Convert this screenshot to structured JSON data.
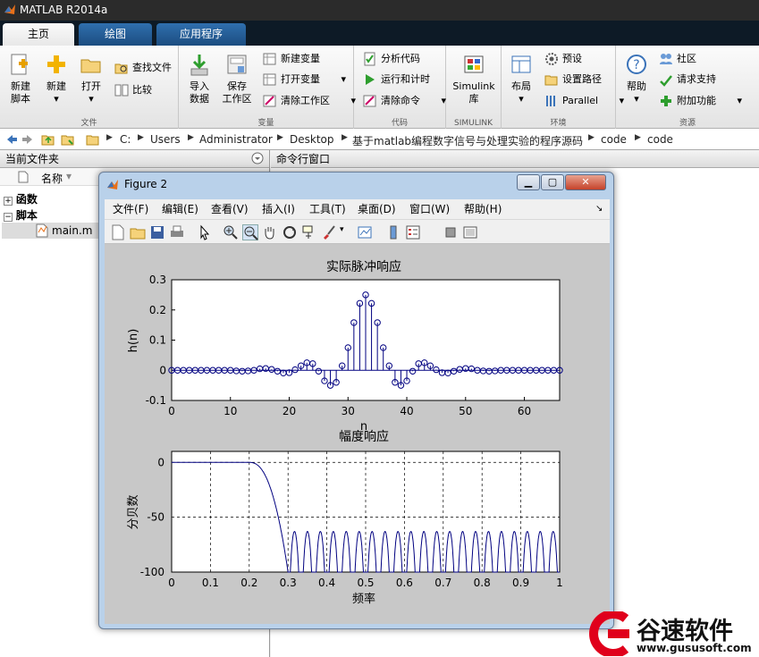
{
  "app": {
    "title": "MATLAB R2014a"
  },
  "tabs": [
    {
      "label": "主页"
    },
    {
      "label": "绘图"
    },
    {
      "label": "应用程序"
    }
  ],
  "ribbon": {
    "file": {
      "label": "文件",
      "new_script": "新建\n脚本",
      "new": "新建",
      "open": "打开",
      "find_files": "查找文件",
      "compare": "比较"
    },
    "variable": {
      "label": "变量",
      "import": "导入\n数据",
      "save_ws": "保存\n工作区",
      "new_var": "新建变量",
      "open_var": "打开变量",
      "clear_ws": "清除工作区"
    },
    "code": {
      "label": "代码",
      "analyze": "分析代码",
      "run_time": "运行和计时",
      "clear_cmd": "清除命令"
    },
    "simulink": {
      "label": "SIMULINK",
      "btn": "Simulink\n库"
    },
    "env": {
      "label": "环境",
      "layout": "布局",
      "prefs": "预设",
      "set_path": "设置路径",
      "parallel": "Parallel"
    },
    "resources": {
      "label": "资源",
      "help": "帮助",
      "community": "社区",
      "support": "请求支持",
      "addons": "附加功能"
    }
  },
  "address": {
    "crumbs": [
      "C:",
      "Users",
      "Administrator",
      "Desktop",
      "基于matlab编程数字信号与处理实验的程序源码",
      "code",
      "code"
    ]
  },
  "left_pane": {
    "header": "当前文件夹",
    "col_name": "名称",
    "tree": [
      {
        "label": "函数",
        "toggle": "+"
      },
      {
        "label": "脚本",
        "toggle": "−"
      },
      {
        "label": "main.m"
      }
    ]
  },
  "cmd_pane": {
    "header": "命令行窗口"
  },
  "figure": {
    "title": "Figure 2",
    "menu": [
      "文件(F)",
      "编辑(E)",
      "查看(V)",
      "插入(I)",
      "工具(T)",
      "桌面(D)",
      "窗口(W)",
      "帮助(H)"
    ]
  },
  "chart_data": [
    {
      "type": "stem",
      "title": "实际脉冲响应",
      "xlabel": "n",
      "ylabel": "h(n)",
      "xlim": [
        0,
        66
      ],
      "ylim": [
        -0.1,
        0.3
      ],
      "xticks": [
        0,
        10,
        20,
        30,
        40,
        50,
        60
      ],
      "yticks": [
        -0.1,
        0,
        0.1,
        0.2,
        0.3
      ],
      "x": [
        0,
        1,
        2,
        3,
        4,
        5,
        6,
        7,
        8,
        9,
        10,
        11,
        12,
        13,
        14,
        15,
        16,
        17,
        18,
        19,
        20,
        21,
        22,
        23,
        24,
        25,
        26,
        27,
        28,
        29,
        30,
        31,
        32,
        33,
        34,
        35,
        36,
        37,
        38,
        39,
        40,
        41,
        42,
        43,
        44,
        45,
        46,
        47,
        48,
        49,
        50,
        51,
        52,
        53,
        54,
        55,
        56,
        57,
        58,
        59,
        60,
        61,
        62,
        63,
        64,
        65,
        66
      ],
      "y": [
        0,
        0,
        0,
        0,
        0,
        0,
        0,
        0,
        0,
        0,
        0,
        -0.002,
        -0.003,
        -0.002,
        0,
        0.005,
        0.006,
        0.003,
        -0.003,
        -0.009,
        -0.008,
        0.002,
        0.015,
        0.025,
        0.022,
        -0.003,
        -0.035,
        -0.05,
        -0.04,
        0.015,
        0.075,
        0.158,
        0.222,
        0.25,
        0.222,
        0.158,
        0.075,
        0.015,
        -0.04,
        -0.05,
        -0.035,
        -0.003,
        0.022,
        0.025,
        0.015,
        0.002,
        -0.008,
        -0.009,
        -0.003,
        0.003,
        0.006,
        0.005,
        0,
        -0.002,
        -0.003,
        -0.002,
        0,
        0,
        0,
        0,
        0,
        0,
        0,
        0,
        0,
        0,
        0
      ],
      "grid": false
    },
    {
      "type": "line",
      "title": "幅度响应",
      "xlabel": "频率",
      "ylabel": "分贝数",
      "xlim": [
        0,
        1
      ],
      "ylim": [
        -100,
        10
      ],
      "xticks": [
        0,
        0.1,
        0.2,
        0.3,
        0.4,
        0.5,
        0.6,
        0.7,
        0.8,
        0.9,
        1
      ],
      "yticks": [
        -100,
        -50,
        0
      ],
      "passband_edge": 0.2,
      "stopband_edge": 0.3,
      "stopband_peak_db": -63,
      "lobe_count": 21,
      "grid": true
    }
  ],
  "watermark": {
    "name": "谷速软件",
    "url": "www.gususoft.com"
  },
  "colors": {
    "series": "#000080",
    "ribbon": "#f0f0f0",
    "tab_active": "#f5f5f5"
  }
}
